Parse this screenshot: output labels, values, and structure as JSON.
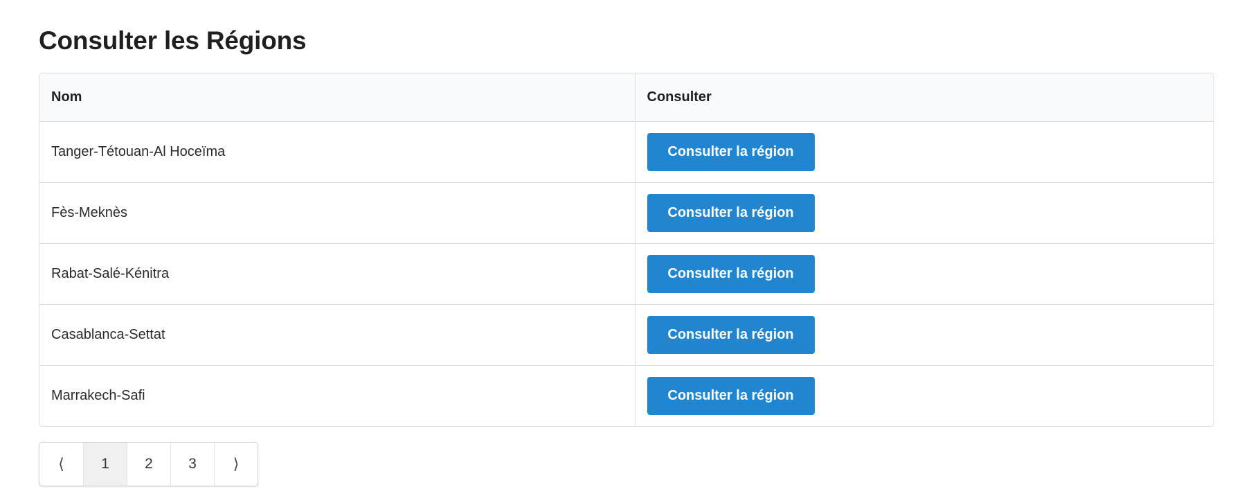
{
  "page": {
    "title": "Consulter les Régions"
  },
  "table": {
    "headers": [
      "Nom",
      "Consulter"
    ],
    "rows": [
      {
        "name": "Tanger-Tétouan-Al Hoceïma",
        "action_label": "Consulter la région"
      },
      {
        "name": "Fès-Meknès",
        "action_label": "Consulter la région"
      },
      {
        "name": "Rabat-Salé-Kénitra",
        "action_label": "Consulter la région"
      },
      {
        "name": "Casablanca-Settat",
        "action_label": "Consulter la région"
      },
      {
        "name": "Marrakech-Safi",
        "action_label": "Consulter la région"
      }
    ]
  },
  "pagination": {
    "prev_symbol": "⟨",
    "pages": [
      "1",
      "2",
      "3"
    ],
    "active_page": "1",
    "next_symbol": "⟩"
  },
  "colors": {
    "button_primary": "#2185d0",
    "header_bg": "#f9fafb",
    "border": "#dcdcdc",
    "active_page_bg": "#f0f0f0"
  }
}
